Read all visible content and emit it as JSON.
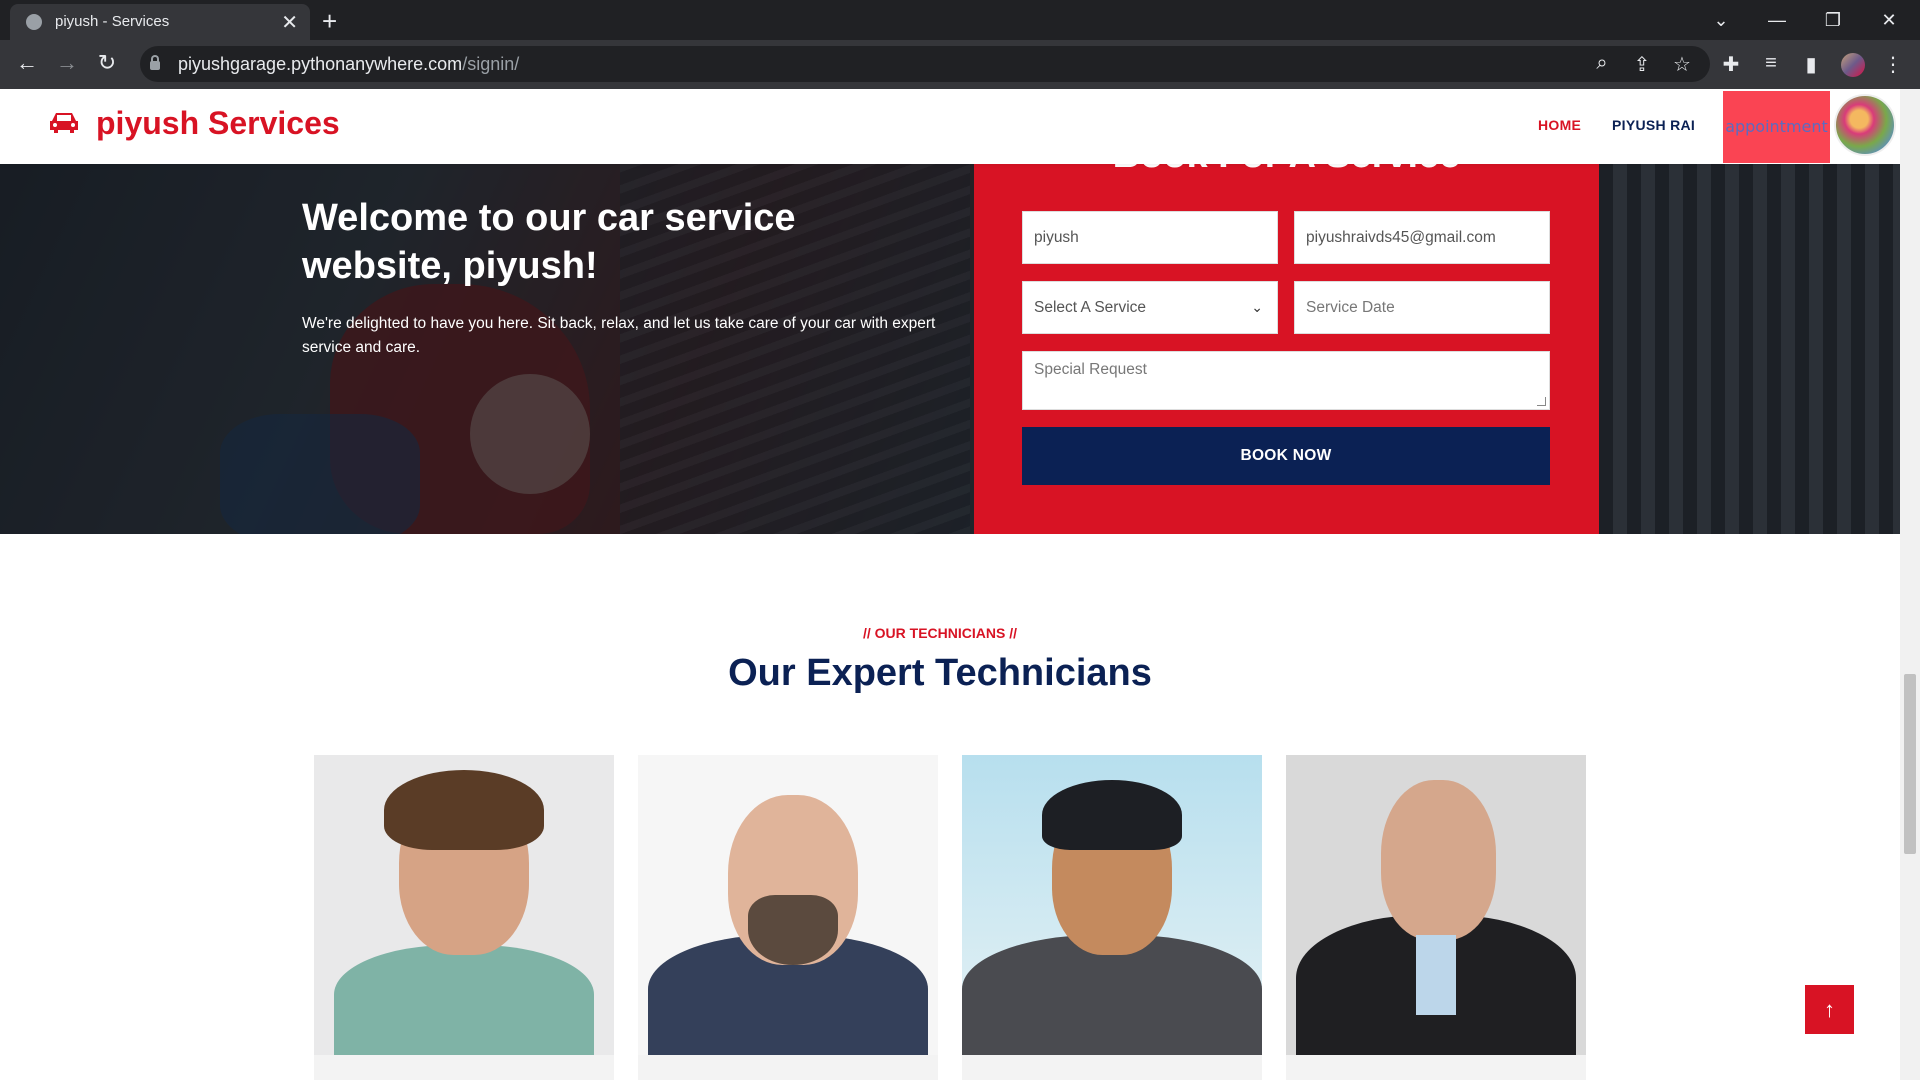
{
  "browser": {
    "tab_title": "piyush - Services",
    "url_host": "piyushgarage.pythonanywhere.com",
    "url_path": "/signin/"
  },
  "header": {
    "brand": "piyush Services",
    "nav": {
      "home": "HOME",
      "user": "PIYUSH RAI",
      "appointment": "appointment"
    }
  },
  "hero": {
    "title": "Welcome to our car service website, piyush!",
    "text": "We're delighted to have you here. Sit back, relax, and let us take care of your car with expert service and care."
  },
  "booking": {
    "title": "Book For A Service",
    "name_value": "piyush",
    "email_value": "piyushraivds45@gmail.com",
    "service_select": "Select A Service",
    "date_placeholder": "Service Date",
    "request_placeholder": "Special Request",
    "button": "BOOK NOW"
  },
  "technicians": {
    "subtitle": "// OUR TECHNICIANS //",
    "title": "Our Expert Technicians"
  },
  "colors": {
    "brand_red": "#d81324",
    "navy": "#0b2154",
    "appointment_bg": "#fa4453"
  },
  "icons": [
    "car-icon",
    "arrow-up-icon",
    "chevron-down-icon",
    "lock-icon"
  ]
}
